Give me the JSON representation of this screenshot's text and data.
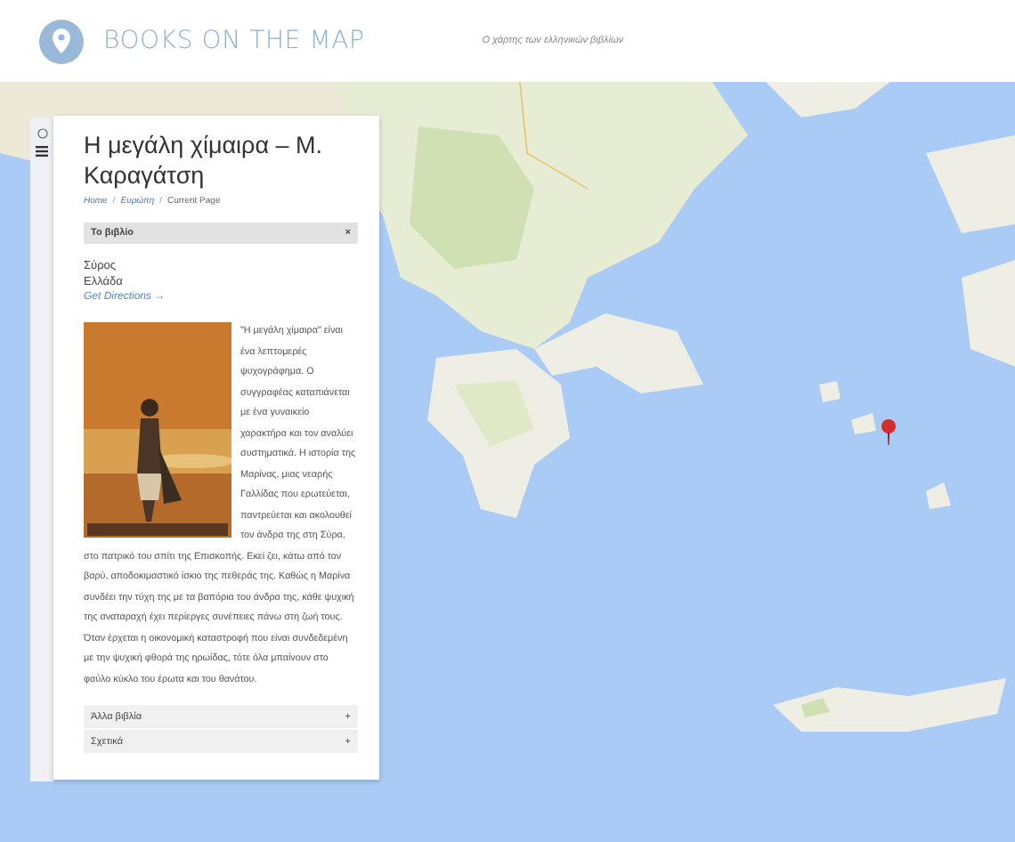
{
  "header": {
    "title": "BOOKS ON THE MAP",
    "tagline": "Ο χάρτης των ελληνικών βιβλίων"
  },
  "panel": {
    "title": "Η μεγάλη χίμαιρα – Μ. Καραγάτση",
    "breadcrumb_separator": "/",
    "breadcrumb": [
      {
        "label": "Home",
        "link": true
      },
      {
        "label": "Ευρώπη",
        "link": true
      },
      {
        "label": "Current Page",
        "link": false
      }
    ],
    "sections": [
      {
        "label": "Το βιβλίο",
        "icon": "×",
        "expanded": true
      },
      {
        "label": "Άλλα βιβλία",
        "icon": "+",
        "expanded": false
      },
      {
        "label": "Σχετικά",
        "icon": "+",
        "expanded": false
      }
    ],
    "location": [
      "Σύρος",
      "Ελλάδα"
    ],
    "directions": "Get Directions →",
    "description": "\"Η μεγάλη χίμαιρα\" είναι ένα λεπτομερές ψυχογράφημα. Ο συγγραφέας καταπιάνεται με ένα γυναικείο χαρακτήρα και τον αναλύει συστηματικά. Η ιστορία της Μαρίνας, μιας νεαρής Γαλλίδας που ερωτεύεται, παντρεύεται και ακολουθεί τον άνδρα της στη Σύρα, στο πατρικό του σπίτι της Επισκοπής. Εκεί ζει, κάτω από τον βαρύ, αποδοκιμαστικό ίσκιο της πεθεράς της. Καθώς η Μαρίνα συνδέει την τύχη της με τα βαπόρια του άνδρα της, κάθε ψυχική της αναταραχή έχει περίεργες συνέπειες πάνω στη ζωή τους. Όταν έρχεται η οικονομική καταστροφή που είναι συνδεδεμένη με την ψυχική φθορά της ηρωίδας, τότε όλα μπαίνουν στο φαύλο κύκλο του έρωτα και του θανάτου."
  }
}
